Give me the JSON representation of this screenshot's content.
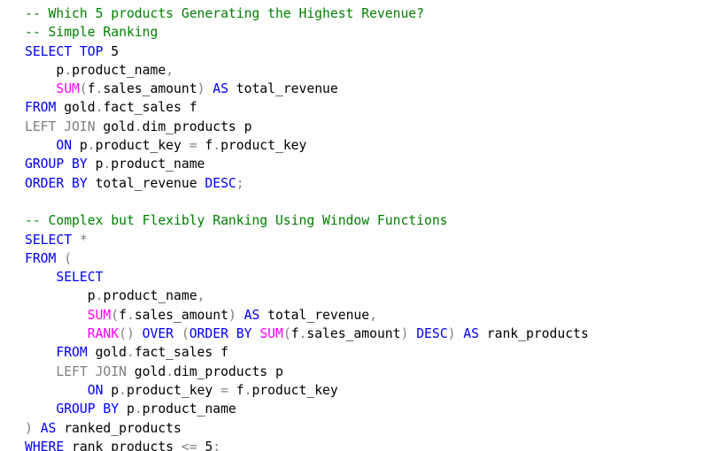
{
  "theme": {
    "keyword": "#0000ff",
    "function": "#ff00ff",
    "gray": "#808080",
    "comment": "#008000",
    "text": "#000000",
    "background": "#ffffff"
  },
  "editor": {
    "lines": [
      [
        {
          "t": "-- Which 5 products Generating the Highest Revenue?",
          "c": "comment"
        }
      ],
      [
        {
          "t": "-- Simple Ranking",
          "c": "comment"
        }
      ],
      [
        {
          "t": "SELECT TOP",
          "c": "keyword"
        },
        {
          "t": " 5",
          "c": "text"
        }
      ],
      [
        {
          "t": "    p",
          "c": "text"
        },
        {
          "t": ".",
          "c": "gray"
        },
        {
          "t": "product_name",
          "c": "text"
        },
        {
          "t": ",",
          "c": "gray"
        }
      ],
      [
        {
          "t": "    ",
          "c": "text"
        },
        {
          "t": "SUM",
          "c": "function"
        },
        {
          "t": "(",
          "c": "gray"
        },
        {
          "t": "f",
          "c": "text"
        },
        {
          "t": ".",
          "c": "gray"
        },
        {
          "t": "sales_amount",
          "c": "text"
        },
        {
          "t": ")",
          "c": "gray"
        },
        {
          "t": " ",
          "c": "text"
        },
        {
          "t": "AS",
          "c": "keyword"
        },
        {
          "t": " total_revenue",
          "c": "text"
        }
      ],
      [
        {
          "t": "FROM",
          "c": "keyword"
        },
        {
          "t": " gold",
          "c": "text"
        },
        {
          "t": ".",
          "c": "gray"
        },
        {
          "t": "fact_sales f",
          "c": "text"
        }
      ],
      [
        {
          "t": "LEFT JOIN",
          "c": "gray"
        },
        {
          "t": " gold",
          "c": "text"
        },
        {
          "t": ".",
          "c": "gray"
        },
        {
          "t": "dim_products p",
          "c": "text"
        }
      ],
      [
        {
          "t": "    ",
          "c": "text"
        },
        {
          "t": "ON",
          "c": "keyword"
        },
        {
          "t": " p",
          "c": "text"
        },
        {
          "t": ".",
          "c": "gray"
        },
        {
          "t": "product_key ",
          "c": "text"
        },
        {
          "t": "=",
          "c": "gray"
        },
        {
          "t": " f",
          "c": "text"
        },
        {
          "t": ".",
          "c": "gray"
        },
        {
          "t": "product_key",
          "c": "text"
        }
      ],
      [
        {
          "t": "GROUP BY",
          "c": "keyword"
        },
        {
          "t": " p",
          "c": "text"
        },
        {
          "t": ".",
          "c": "gray"
        },
        {
          "t": "product_name",
          "c": "text"
        }
      ],
      [
        {
          "t": "ORDER BY",
          "c": "keyword"
        },
        {
          "t": " total_revenue ",
          "c": "text"
        },
        {
          "t": "DESC",
          "c": "keyword"
        },
        {
          "t": ";",
          "c": "gray"
        }
      ],
      [
        {
          "t": "",
          "c": "text"
        }
      ],
      [
        {
          "t": "-- Complex but Flexibly Ranking Using Window Functions",
          "c": "comment"
        }
      ],
      [
        {
          "t": "SELECT",
          "c": "keyword"
        },
        {
          "t": " ",
          "c": "text"
        },
        {
          "t": "*",
          "c": "gray"
        }
      ],
      [
        {
          "t": "FROM",
          "c": "keyword"
        },
        {
          "t": " ",
          "c": "text"
        },
        {
          "t": "(",
          "c": "gray"
        }
      ],
      [
        {
          "t": "    ",
          "c": "text"
        },
        {
          "t": "SELECT",
          "c": "keyword"
        }
      ],
      [
        {
          "t": "        p",
          "c": "text"
        },
        {
          "t": ".",
          "c": "gray"
        },
        {
          "t": "product_name",
          "c": "text"
        },
        {
          "t": ",",
          "c": "gray"
        }
      ],
      [
        {
          "t": "        ",
          "c": "text"
        },
        {
          "t": "SUM",
          "c": "function"
        },
        {
          "t": "(",
          "c": "gray"
        },
        {
          "t": "f",
          "c": "text"
        },
        {
          "t": ".",
          "c": "gray"
        },
        {
          "t": "sales_amount",
          "c": "text"
        },
        {
          "t": ")",
          "c": "gray"
        },
        {
          "t": " ",
          "c": "text"
        },
        {
          "t": "AS",
          "c": "keyword"
        },
        {
          "t": " total_revenue",
          "c": "text"
        },
        {
          "t": ",",
          "c": "gray"
        }
      ],
      [
        {
          "t": "        ",
          "c": "text"
        },
        {
          "t": "RANK",
          "c": "function"
        },
        {
          "t": "()",
          "c": "gray"
        },
        {
          "t": " ",
          "c": "text"
        },
        {
          "t": "OVER",
          "c": "keyword"
        },
        {
          "t": " ",
          "c": "text"
        },
        {
          "t": "(",
          "c": "gray"
        },
        {
          "t": "ORDER BY",
          "c": "keyword"
        },
        {
          "t": " ",
          "c": "text"
        },
        {
          "t": "SUM",
          "c": "function"
        },
        {
          "t": "(",
          "c": "gray"
        },
        {
          "t": "f",
          "c": "text"
        },
        {
          "t": ".",
          "c": "gray"
        },
        {
          "t": "sales_amount",
          "c": "text"
        },
        {
          "t": ")",
          "c": "gray"
        },
        {
          "t": " ",
          "c": "text"
        },
        {
          "t": "DESC",
          "c": "keyword"
        },
        {
          "t": ")",
          "c": "gray"
        },
        {
          "t": " ",
          "c": "text"
        },
        {
          "t": "AS",
          "c": "keyword"
        },
        {
          "t": " rank_products",
          "c": "text"
        }
      ],
      [
        {
          "t": "    ",
          "c": "text"
        },
        {
          "t": "FROM",
          "c": "keyword"
        },
        {
          "t": " gold",
          "c": "text"
        },
        {
          "t": ".",
          "c": "gray"
        },
        {
          "t": "fact_sales f",
          "c": "text"
        }
      ],
      [
        {
          "t": "    ",
          "c": "text"
        },
        {
          "t": "LEFT JOIN",
          "c": "gray"
        },
        {
          "t": " gold",
          "c": "text"
        },
        {
          "t": ".",
          "c": "gray"
        },
        {
          "t": "dim_products p",
          "c": "text"
        }
      ],
      [
        {
          "t": "        ",
          "c": "text"
        },
        {
          "t": "ON",
          "c": "keyword"
        },
        {
          "t": " p",
          "c": "text"
        },
        {
          "t": ".",
          "c": "gray"
        },
        {
          "t": "product_key ",
          "c": "text"
        },
        {
          "t": "=",
          "c": "gray"
        },
        {
          "t": " f",
          "c": "text"
        },
        {
          "t": ".",
          "c": "gray"
        },
        {
          "t": "product_key",
          "c": "text"
        }
      ],
      [
        {
          "t": "    ",
          "c": "text"
        },
        {
          "t": "GROUP BY",
          "c": "keyword"
        },
        {
          "t": " p",
          "c": "text"
        },
        {
          "t": ".",
          "c": "gray"
        },
        {
          "t": "product_name",
          "c": "text"
        }
      ],
      [
        {
          "t": ")",
          "c": "gray"
        },
        {
          "t": " ",
          "c": "text"
        },
        {
          "t": "AS",
          "c": "keyword"
        },
        {
          "t": " ranked_products",
          "c": "text"
        }
      ],
      [
        {
          "t": "WHERE",
          "c": "keyword"
        },
        {
          "t": " rank_products ",
          "c": "text"
        },
        {
          "t": "<=",
          "c": "gray"
        },
        {
          "t": " 5",
          "c": "text"
        },
        {
          "t": ";",
          "c": "gray"
        }
      ]
    ]
  }
}
